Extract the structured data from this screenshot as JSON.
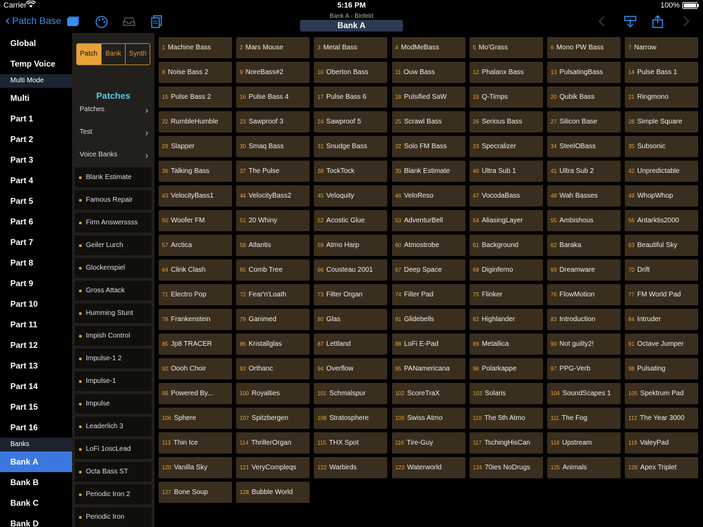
{
  "status": {
    "carrier": "Carrier",
    "time": "5:16 PM",
    "battery_pct": "100%",
    "battery_level": 1.0
  },
  "nav": {
    "back_label": "Patch Base",
    "subtitle": "Bank A - Blofeld",
    "title": "Bank A"
  },
  "sidebar": {
    "top": [
      "Global",
      "Temp Voice"
    ],
    "multi_section": "Multi Mode",
    "parts": [
      "Multi",
      "Part 1",
      "Part 2",
      "Part 3",
      "Part 4",
      "Part 5",
      "Part 6",
      "Part 7",
      "Part 8",
      "Part 9",
      "Part 10",
      "Part 11",
      "Part 12",
      "Part 13",
      "Part 14",
      "Part 15",
      "Part 16"
    ],
    "banks_section": "Banks",
    "banks": [
      "Bank A",
      "Bank B",
      "Bank C",
      "Bank D"
    ],
    "selected_bank": "Bank A"
  },
  "middle": {
    "segments": [
      "Patch",
      "Bank",
      "Synth"
    ],
    "active_segment": "Patch",
    "title": "Patches",
    "folders": [
      "Patches",
      "Test",
      "Voice Banks"
    ],
    "patches": [
      "Blank Estimate",
      "Famous Repair",
      "Firm Answerssss",
      "Geiler Lurch",
      "Glockenspiel",
      "Gross Attack",
      "Humming Stunt",
      "Impish Control",
      "Impulse-1 2",
      "Impulse-1",
      "Impulse",
      "Leaderlich 3",
      "LoFi 1oscLead",
      "Octa Bass     ST",
      "Periodic Iron 2",
      "Periodic Iron"
    ]
  },
  "grid": {
    "patches": [
      "Machine Bass",
      "Mars Mouse",
      "Metal Bass",
      "ModMeBass",
      "Mo'Grass",
      "Mono PW Bass",
      "Narrow",
      "Noise Bass 2",
      "NoreBass#2",
      "Oberton Bass",
      "Ouw Bass",
      "Phalanx Bass",
      "PulsatingBass",
      "Pulse Bass 1",
      "Pulse Bass 2",
      "Pulse Bass 4",
      "Pulse Bass 6",
      "Pulsified SaW",
      "Q-Timps",
      "Qubik Bass",
      "Ringmono",
      "RumbleHumble",
      "Sawproof 3",
      "Sawproof 5",
      "Scrawl Bass",
      "Serious Bass",
      "Silicon Base",
      "Simple Square",
      "Slapper",
      "Smaq Bass",
      "Snudge Bass",
      "Solo FM Bass",
      "Specralizer",
      "SteelOBass",
      "Subsonic",
      "Talking Bass",
      "The Pulse",
      "TockTock",
      "Blank Estimate",
      "Ultra Sub 1",
      "Ultra Sub 2",
      "Unpredictable",
      "VelocityBass1",
      "VelocityBass2",
      "Veloquity",
      "VeloReso",
      "VocodaBass",
      "Wah Basses",
      "WhopWhop",
      "Woofer FM",
      "20 Whiny",
      "Acostic Glue",
      "AdventurBell",
      "AliasingLayer",
      "Ambishous",
      "Antarktis2000",
      "Arctica",
      "Atlantis",
      "Atmo Harp",
      "Atmostrobe",
      "Background",
      "Baraka",
      "Beautiful Sky",
      "Clink Clash",
      "Comb Tree",
      "Cousteau 2001",
      "Deep Space",
      "Diginferno",
      "Dreamware",
      "Drift",
      "Electro Pop",
      "Fear'n'Loath",
      "Filter Organ",
      "Filter Pad",
      "Flinker",
      "FlowMotion",
      "FM World Pad",
      "Frankenstein",
      "Ganimed",
      "Glas",
      "Glidebells",
      "Highlander",
      "Introduction",
      "Intruder",
      "Jp8 TRACER",
      "Kristallglas",
      "Lettland",
      "LoFi E-Pad",
      "Metallica",
      "Not guilty2!",
      "Octave Jumper",
      "Oooh Choir",
      "Orthanc",
      "Overflow",
      "PANamericana",
      "Polarkappe",
      "PPG-Verb",
      "Pulsating",
      "Powered By...",
      "Royalties",
      "Schmalspur",
      "ScoreTraX",
      "Solaris",
      "SoundScapes 1",
      "Spektrum Pad",
      "Sphere",
      "Spitzbergen",
      "Stratosphere",
      "Swiss Atmo",
      "The 5th Atmo",
      "The Fog",
      "The Year 3000",
      "Thin Ice",
      "ThrillerOrgan",
      "THX Spot",
      "Tire-Guy",
      "TschingHisCan",
      "Upstream",
      "ValeyPad",
      "Vanilla Sky",
      "VeryCompleqs",
      "Warbirds",
      "Waterworld",
      "70ies NoDrugs",
      "Animals",
      "Apex Triplet",
      "Bone Soup",
      "Bubble World"
    ]
  },
  "colors": {
    "accent": "#e8a23a",
    "selected": "#3a78e0",
    "title": "#5cc8e8",
    "cell": "#3a2e1e"
  }
}
